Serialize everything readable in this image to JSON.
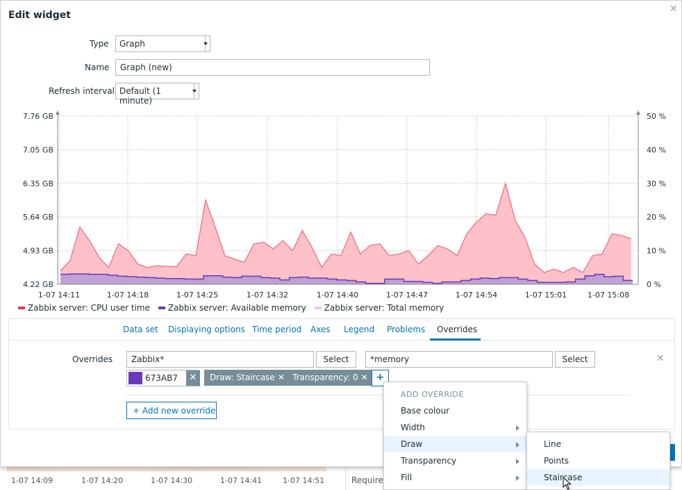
{
  "dialog": {
    "title": "Edit widget"
  },
  "form": {
    "type_label": "Type",
    "type_value": "Graph",
    "name_label": "Name",
    "name_value": "Graph (new)",
    "refresh_label": "Refresh interval",
    "refresh_value": "Default (1 minute)"
  },
  "chart_data": {
    "type": "area",
    "title": "",
    "y_left_ticks": [
      "4.22 GB",
      "4.93 GB",
      "5.64 GB",
      "6.35 GB",
      "7.05 GB",
      "7.76 GB"
    ],
    "y_right_ticks": [
      "0 %",
      "10 %",
      "20 %",
      "30 %",
      "40 %",
      "50 %"
    ],
    "x_ticks": [
      "1-07 14:11",
      "1-07 14:18",
      "1-07 14:25",
      "1-07 14:32",
      "1-07 14:40",
      "1-07 14:47",
      "1-07 14:54",
      "1-07 15:01",
      "1-07 15:08"
    ],
    "ylim_left": [
      4.22,
      7.76
    ],
    "ylim_right": [
      0,
      50
    ],
    "grid": true,
    "series": [
      {
        "name": "Zabbix server: CPU user time",
        "axis": "right",
        "color": "#e8394a",
        "fill": "#ffc1c9",
        "values": [
          4,
          7,
          17,
          13,
          8,
          5,
          12,
          10,
          6,
          5,
          5.5,
          5.3,
          5.2,
          9,
          8.5,
          25,
          17,
          8.5,
          7.5,
          6.5,
          12,
          12.5,
          10.5,
          13,
          10,
          16,
          11,
          5,
          9,
          8.5,
          15.5,
          9,
          11.5,
          12,
          8.5,
          9,
          10,
          6,
          8.5,
          11.5,
          10.5,
          8.5,
          15,
          18.5,
          21,
          20.5,
          30,
          19,
          14,
          6,
          3.5,
          4.5,
          3.5,
          5,
          3.5,
          8.5,
          9,
          15,
          14.5,
          13.5
        ]
      },
      {
        "name": "Zabbix server: Available memory",
        "axis": "left",
        "style": "staircase",
        "color": "#673AB7",
        "fill": "#b49bd6",
        "values": [
          4.43,
          4.44,
          4.44,
          4.43,
          4.43,
          4.41,
          4.39,
          4.38,
          4.37,
          4.36,
          4.35,
          4.34,
          4.34,
          4.33,
          4.33,
          4.4,
          4.4,
          4.37,
          4.36,
          4.39,
          4.39,
          4.36,
          4.35,
          4.31,
          4.36,
          4.37,
          4.35,
          4.35,
          4.33,
          4.31,
          4.3,
          4.27,
          4.24,
          4.24,
          4.33,
          4.33,
          4.28,
          4.28,
          4.26,
          4.24,
          4.27,
          4.27,
          4.3,
          4.33,
          4.35,
          4.34,
          4.36,
          4.36,
          4.33,
          4.3,
          4.26,
          4.26,
          4.26,
          4.27,
          4.33,
          4.4,
          4.43,
          4.38,
          4.39,
          4.3
        ]
      },
      {
        "name": "Zabbix server: Total memory",
        "axis": "left",
        "color": "#e4c7f0",
        "values": []
      }
    ]
  },
  "tabs": [
    {
      "label": "Data set"
    },
    {
      "label": "Displaying options"
    },
    {
      "label": "Time period"
    },
    {
      "label": "Axes"
    },
    {
      "label": "Legend"
    },
    {
      "label": "Problems"
    },
    {
      "label": "Overrides"
    }
  ],
  "overrides": {
    "label": "Overrides",
    "host_value": "Zabbix*",
    "item_value": "*memory",
    "select_label": "Select",
    "color_value": "673AB7",
    "color": "#673AB7",
    "chips": [
      "Draw: Staircase",
      "Transparency: 0"
    ],
    "add_new_label": "Add new override"
  },
  "add_override_menu": {
    "header": "ADD OVERRIDE",
    "items": [
      {
        "label": "Base colour",
        "submenu": false
      },
      {
        "label": "Width",
        "submenu": true
      },
      {
        "label": "Draw",
        "submenu": true
      },
      {
        "label": "Transparency",
        "submenu": true
      },
      {
        "label": "Fill",
        "submenu": true
      }
    ]
  },
  "draw_submenu": {
    "items": [
      "Line",
      "Points",
      "Staircase"
    ]
  },
  "background": {
    "x_ticks": [
      "1-07 14:09",
      "1-07 14:20",
      "1-07 14:30",
      "1-07 14:41",
      "1-07 14:51"
    ],
    "partial_text": "Require"
  }
}
